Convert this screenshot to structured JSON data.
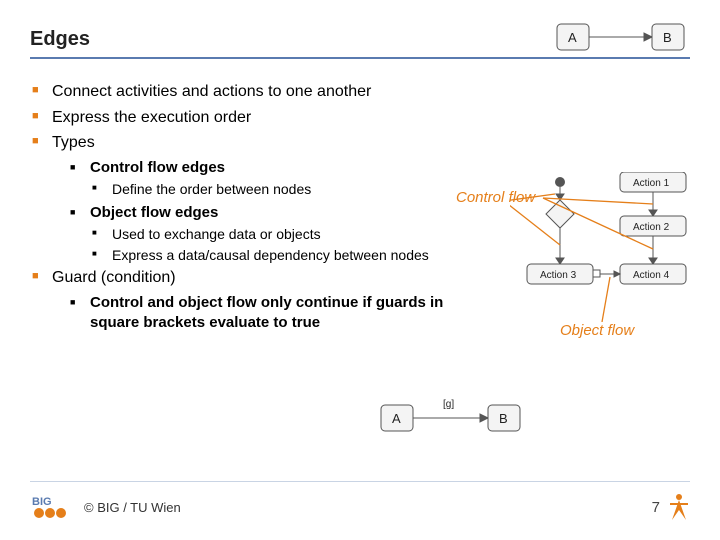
{
  "title": "Edges",
  "bullets": {
    "b1": "Connect activities and actions to one another",
    "b2": "Express the execution order",
    "b3": "Types",
    "b3a": "Control flow edges",
    "b3a1": "Define the order between nodes",
    "b3b": "Object flow edges",
    "b3b1": "Used to exchange data or objects",
    "b3b2": "Express a data/causal dependency between nodes",
    "b4": "Guard (condition)",
    "b4a": "Control and object flow only continue if guards in square brackets evaluate to true"
  },
  "labels": {
    "control_flow": "Control flow",
    "object_flow": "Object flow"
  },
  "figures": {
    "ab": {
      "A": "A",
      "B": "B"
    },
    "actions": {
      "a1": "Action 1",
      "a2": "Action 2",
      "a3": "Action 3",
      "a4": "Action 4"
    },
    "guard": {
      "A": "A",
      "B": "B",
      "g": "[g]"
    }
  },
  "footer": {
    "copyright": "© BIG / TU Wien",
    "page": "7"
  },
  "colors": {
    "accent": "#e57f1a",
    "rule": "#5a7bb0"
  }
}
